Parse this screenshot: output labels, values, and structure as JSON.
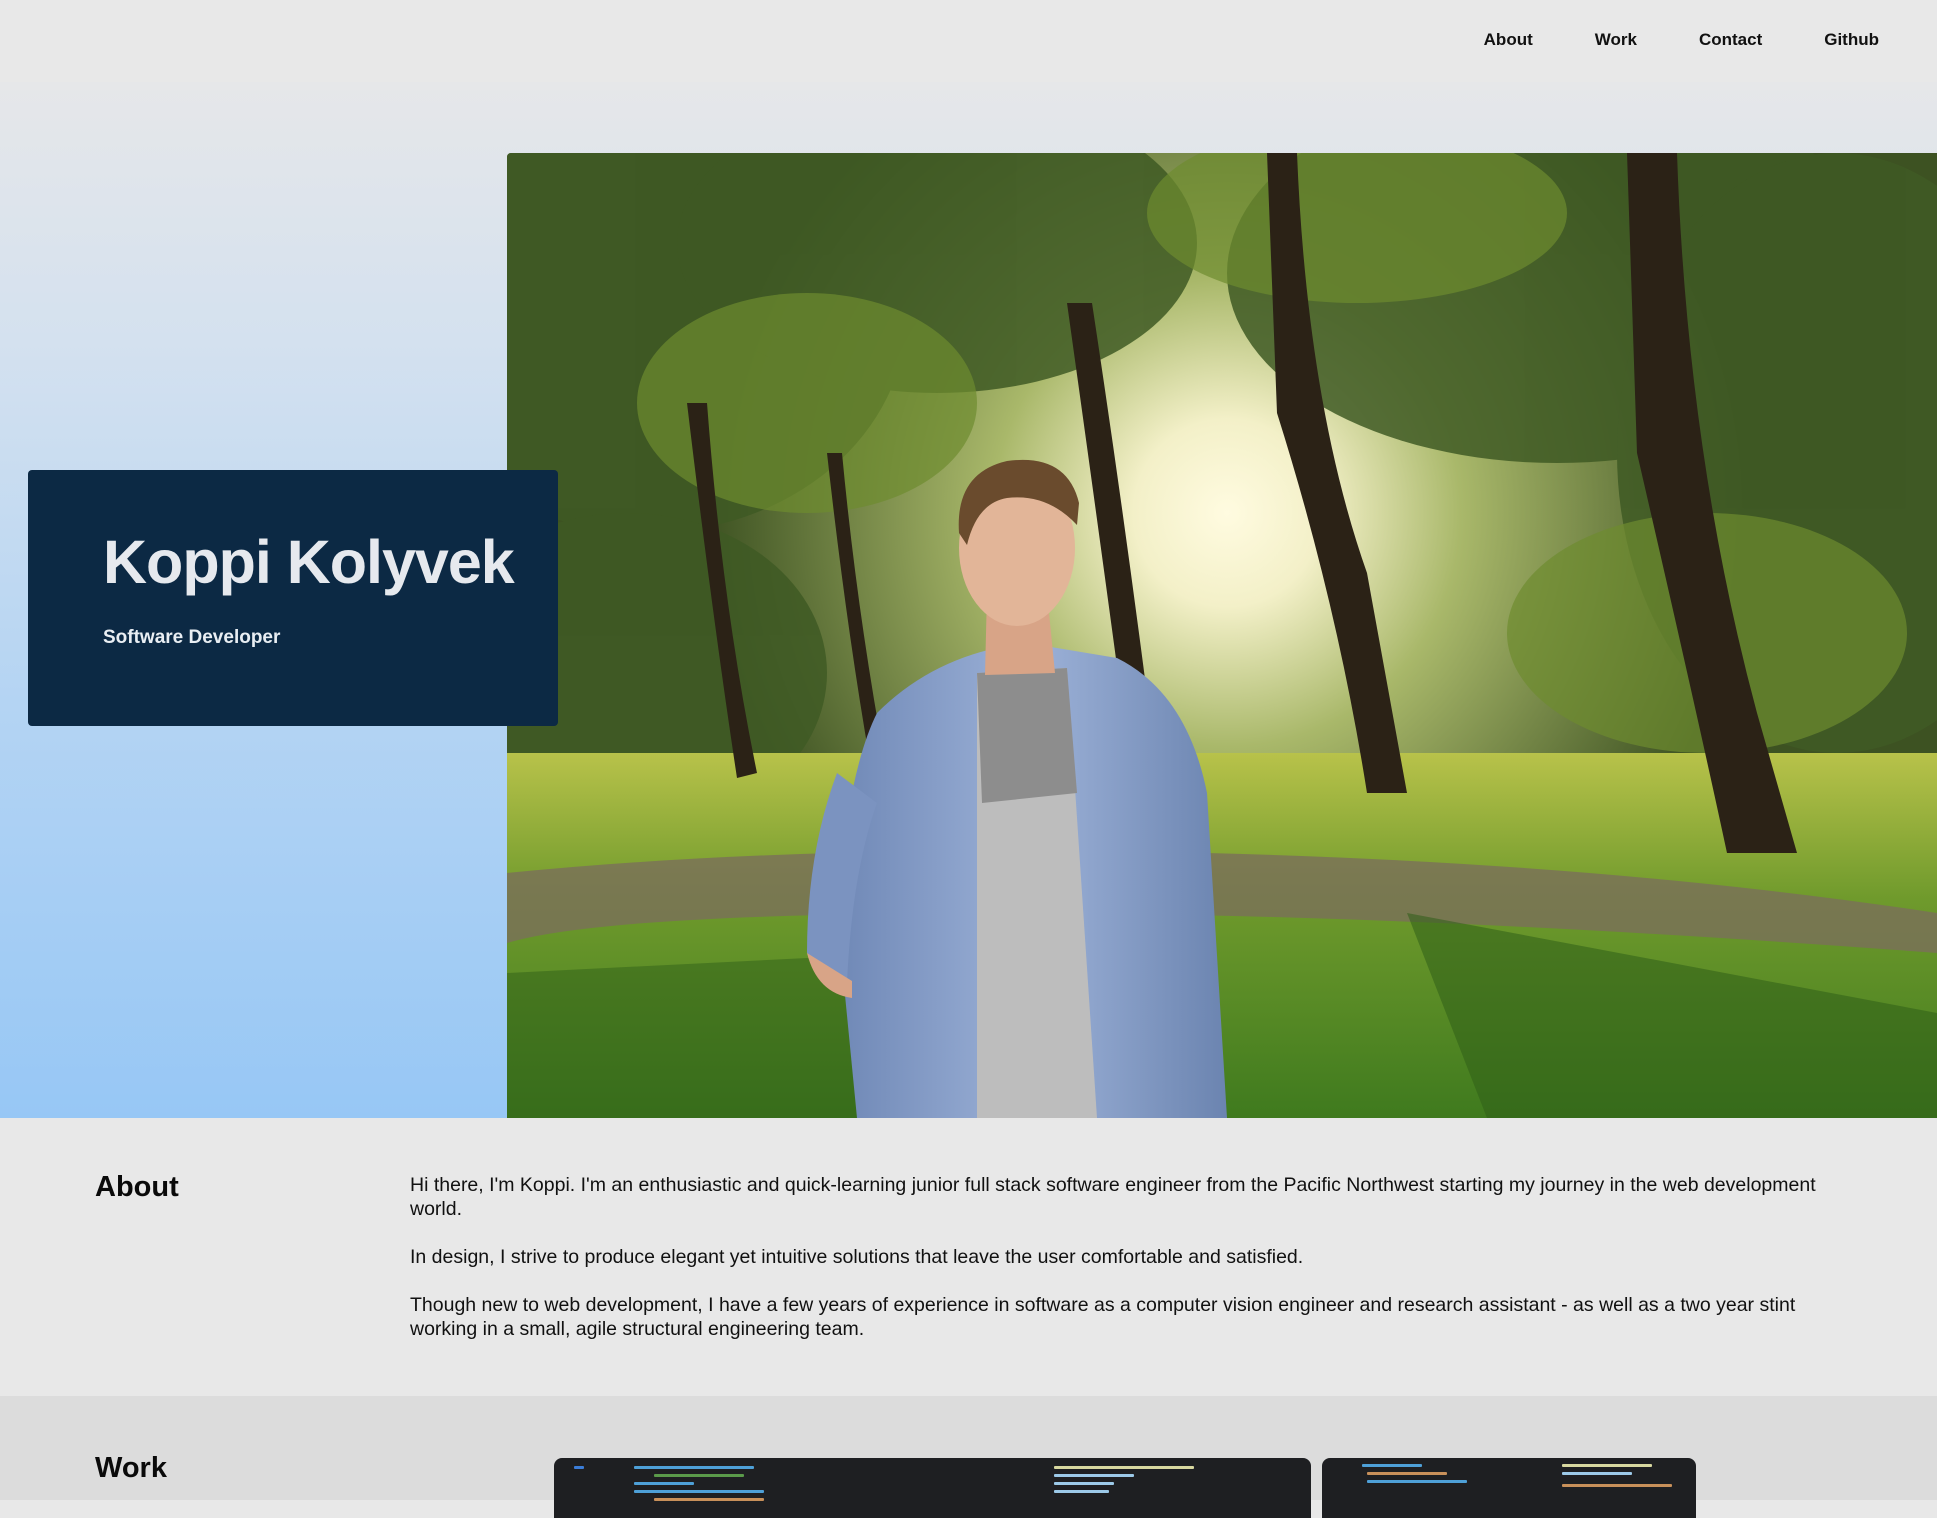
{
  "nav": {
    "items": [
      {
        "id": "about",
        "label": "About"
      },
      {
        "id": "work",
        "label": "Work"
      },
      {
        "id": "contact",
        "label": "Contact"
      },
      {
        "id": "github",
        "label": "Github"
      }
    ]
  },
  "hero": {
    "name": "Koppi Kolyvek",
    "role": "Software Developer",
    "card_color": "#0c2944"
  },
  "about": {
    "title": "About",
    "paragraphs": [
      "Hi there, I'm Koppi. I'm an enthusiastic and quick-learning junior full stack software engineer from the Pacific Northwest starting my journey in the web development world.",
      "In design, I strive to produce elegant yet intuitive solutions that leave the user comfortable and satisfied.",
      "Though new to web development, I have a few years of experience in software as a computer vision engineer and research assistant - as well as a two year stint working in a small, agile structural engineering team."
    ]
  },
  "work": {
    "title": "Work"
  }
}
